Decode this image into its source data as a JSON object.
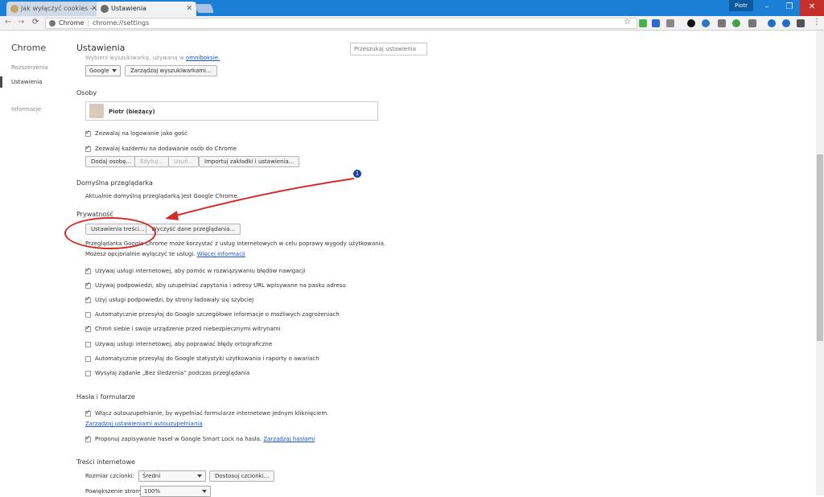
{
  "tabs": [
    {
      "label": "Jak wyłączyć cookies – ..."
    },
    {
      "label": "Ustawienia"
    }
  ],
  "window": {
    "user": "Piotr"
  },
  "omnibox": {
    "chip": "Chrome",
    "url": "chrome://settings"
  },
  "leftnav": {
    "brand": "Chrome",
    "items": [
      {
        "label": "Rozszerzenia"
      },
      {
        "label": "Ustawienia"
      },
      {
        "label": "Informacje"
      }
    ]
  },
  "header": {
    "title": "Ustawienia",
    "search_placeholder": "Przeszukaj ustawienia"
  },
  "search_engine": {
    "partial_text": "Wybierz wyszukiwarkę, używaną w",
    "partial_link": "omniboksie.",
    "select_value": "Google",
    "manage_button": "Zarządzaj wyszukiwarkami..."
  },
  "people": {
    "heading": "Osoby",
    "profile_name": "Piotr (bieżący)",
    "options": [
      {
        "label": "Zezwalaj na logowanie jako gość",
        "checked": true
      },
      {
        "label": "Zezwalaj każdemu na dodawanie osób do Chrome",
        "checked": true
      }
    ],
    "buttons": {
      "add": "Dodaj osobę...",
      "edit": "Edytuj...",
      "remove": "Usuń...",
      "import": "Importuj zakładki i ustawienia..."
    }
  },
  "default_browser": {
    "heading": "Domyślna przeglądarka",
    "text": "Aktualnie domyślną przeglądarką jest Google Chrome."
  },
  "privacy": {
    "heading": "Prywatność",
    "content_settings_button": "Ustawienia treści...",
    "clear_data_button": "Wyczyść dane przeglądania...",
    "desc_line1": "Przeglądarka Google Chrome może korzystać z usług internetowych w celu poprawy wygody użytkowania.",
    "desc_line2": "Możesz opcjonalnie wyłączyć te usługi.",
    "learn_more": "Więcej informacji",
    "options": [
      {
        "label": "Używaj usługi internetowej, aby pomóc w rozwiązywaniu błędów nawigacji",
        "checked": true
      },
      {
        "label": "Używaj podpowiedzi, aby uzupełniać zapytania i adresy URL wpisywane na pasku adresu",
        "checked": true
      },
      {
        "label": "Użyj usługi podpowiedzi, by strony ładowały się szybciej",
        "checked": true
      },
      {
        "label": "Automatycznie przesyłaj do Google szczegółowe informacje o możliwych zagrożeniach",
        "checked": false
      },
      {
        "label": "Chroń siebie i swoje urządzenie przed niebezpiecznymi witrynami",
        "checked": true
      },
      {
        "label": "Używaj usługi internetowej, aby poprawiać błędy ortograficzne",
        "checked": false
      },
      {
        "label": "Automatycznie przesyłaj do Google statystyki użytkowania i raporty o awariach",
        "checked": false
      },
      {
        "label": "Wysyłaj żądanie „Bez śledzenia” podczas przeglądania",
        "checked": false
      }
    ]
  },
  "passwords": {
    "heading": "Hasła i formularze",
    "autofill_label": "Włącz autouzupełnianie, by wypełniać formularze internetowe jednym kliknięciem.",
    "autofill_checked": true,
    "manage_autofill_link": "Zarządzaj ustawieniami autouzupełniania",
    "smartlock_label": "Proponuj zapisywanie haseł w Google Smart Lock na hasła.",
    "smartlock_checked": true,
    "manage_passwords_link": "Zarządzaj hasłami"
  },
  "web_content": {
    "heading": "Treści internetowe",
    "font_size_label": "Rozmiar czcionki:",
    "font_size_value": "Średni",
    "customize_fonts_button": "Dostosuj czcionki...",
    "zoom_label": "Powiększenie strony:",
    "zoom_value": "100%"
  },
  "annotation": {
    "marker": "1"
  },
  "colors": {
    "accent": "#1c7fd6",
    "link": "#1a56c8",
    "annotation": "#d42a2a"
  }
}
